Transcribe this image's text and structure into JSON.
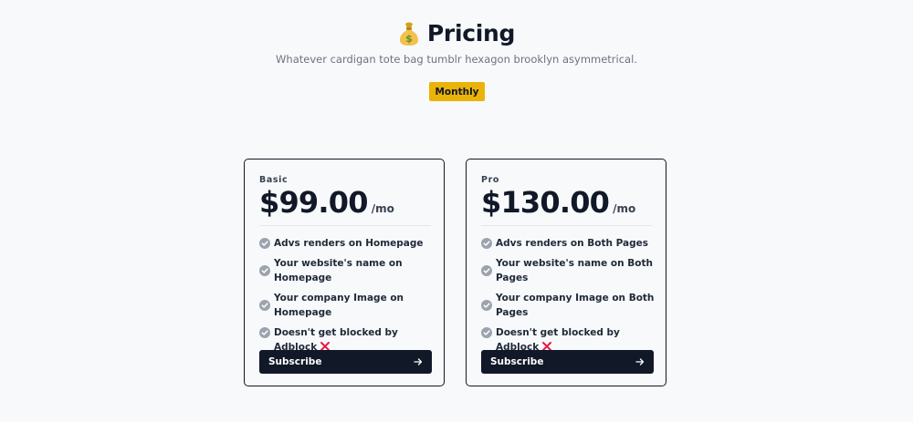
{
  "header": {
    "title": "Pricing",
    "subtitle": "Whatever cardigan tote bag tumblr hexagon brooklyn asymmetrical.",
    "title_icon": "money-bag-icon"
  },
  "billing_toggle": {
    "label": "Monthly"
  },
  "plans": [
    {
      "name": "Basic",
      "price": "$99.00",
      "period": "/mo",
      "features": [
        "Advs renders on Homepage",
        "Your website's name on Homepage",
        "Your company Image on Homepage",
        "Doesn't get blocked by Adblock"
      ],
      "subscribe_label": "Subscribe"
    },
    {
      "name": "Pro",
      "price": "$130.00",
      "period": "/mo",
      "features": [
        "Advs renders on Both Pages",
        "Your website's name on Both Pages",
        "Your company Image on Both Pages",
        "Doesn't get blocked by Adblock"
      ],
      "subscribe_label": "Subscribe"
    }
  ],
  "colors": {
    "accent": "#eab308",
    "button_dark": "#111827",
    "check": "#9ca3af",
    "cross": "#e11d48"
  }
}
